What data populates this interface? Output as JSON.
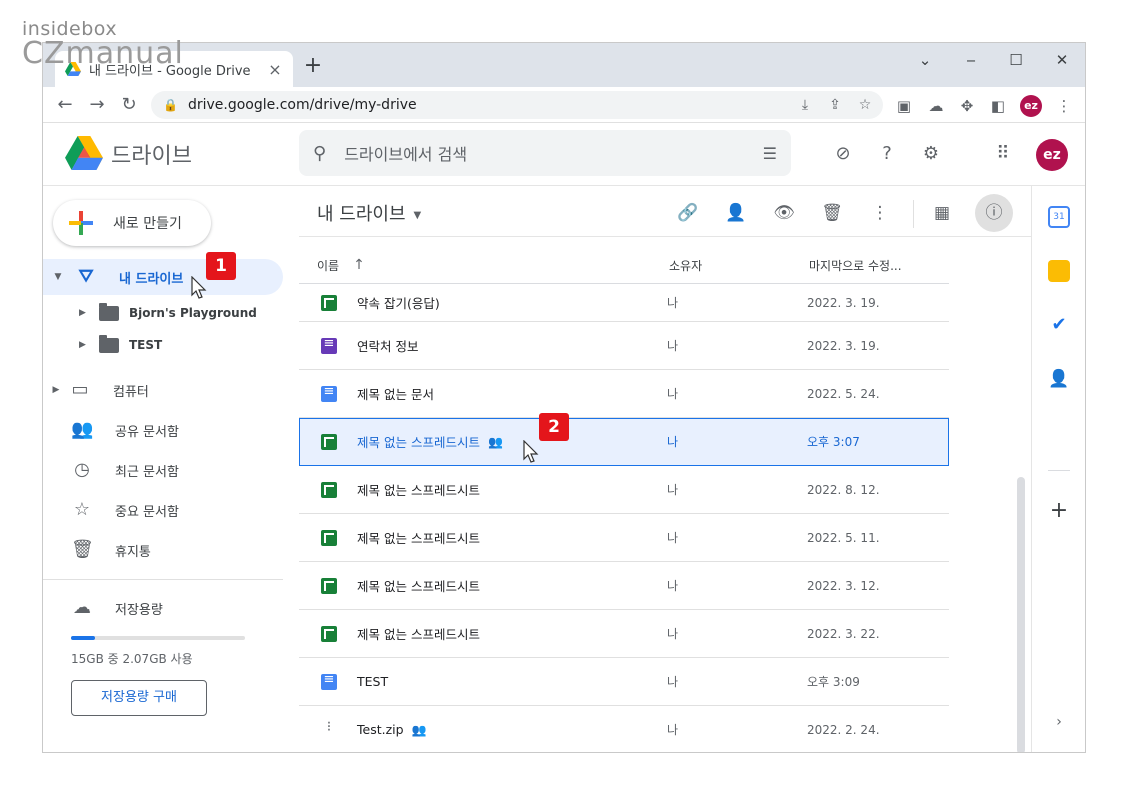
{
  "watermark": {
    "line1": "insidebox",
    "line2": "CZmanual"
  },
  "browser": {
    "tab_title": "내 드라이브 - Google Drive",
    "tab_close": "×",
    "new_tab": "+",
    "url": "drive.google.com/drive/my-drive",
    "window_controls": {
      "minimize": "‒",
      "maximize": "☐",
      "close": "✕",
      "list": "⌄"
    },
    "profile_initials": "ez"
  },
  "drive": {
    "brand": "드라이브",
    "search_placeholder": "드라이브에서 검색",
    "account_initials": "ez"
  },
  "sidebar": {
    "new_button": "새로 만들기",
    "my_drive": "내 드라이브",
    "folders": [
      "Bjorn's Playground",
      "TEST"
    ],
    "items": [
      {
        "label": "컴퓨터",
        "icon": "computer-icon"
      },
      {
        "label": "공유 문서함",
        "icon": "people-icon"
      },
      {
        "label": "최근 문서함",
        "icon": "clock-icon"
      },
      {
        "label": "중요 문서함",
        "icon": "star-icon"
      },
      {
        "label": "휴지통",
        "icon": "trash-icon"
      }
    ],
    "storage_label": "저장용량",
    "storage_usage_text": "15GB 중 2.07GB 사용",
    "storage_fraction": 0.138,
    "buy_storage": "저장용량 구매"
  },
  "main": {
    "breadcrumb": "내 드라이브",
    "columns": {
      "name": "이름",
      "owner": "소유자",
      "modified": "마지막으로 수정..."
    },
    "files": [
      {
        "name": "약속 잡기(응답)",
        "type": "sheet",
        "owner": "나",
        "modified": "2022. 3. 19.",
        "shared": false
      },
      {
        "name": "연락처 정보",
        "type": "form",
        "owner": "나",
        "modified": "2022. 3. 19.",
        "shared": false
      },
      {
        "name": "제목 없는 문서",
        "type": "doc",
        "owner": "나",
        "modified": "2022. 5. 24.",
        "shared": false
      },
      {
        "name": "제목 없는 스프레드시트",
        "type": "sheet",
        "owner": "나",
        "modified": "오후 3:07",
        "shared": true
      },
      {
        "name": "제목 없는 스프레드시트",
        "type": "sheet",
        "owner": "나",
        "modified": "2022. 8. 12.",
        "shared": false
      },
      {
        "name": "제목 없는 스프레드시트",
        "type": "sheet",
        "owner": "나",
        "modified": "2022. 5. 11.",
        "shared": false
      },
      {
        "name": "제목 없는 스프레드시트",
        "type": "sheet",
        "owner": "나",
        "modified": "2022. 3. 12.",
        "shared": false
      },
      {
        "name": "제목 없는 스프레드시트",
        "type": "sheet",
        "owner": "나",
        "modified": "2022. 3. 22.",
        "shared": false
      },
      {
        "name": "TEST",
        "type": "doc",
        "owner": "나",
        "modified": "오후 3:09",
        "shared": false
      },
      {
        "name": "Test.zip",
        "type": "zip",
        "owner": "나",
        "modified": "2022. 2. 24.",
        "shared": true
      }
    ],
    "selected_index": 3
  },
  "badges": [
    "1",
    "2"
  ],
  "colors": {
    "accent": "#1a73e8",
    "active_bg": "#e8f0fe",
    "badge": "#e4151b",
    "avatar": "#b0124e"
  }
}
